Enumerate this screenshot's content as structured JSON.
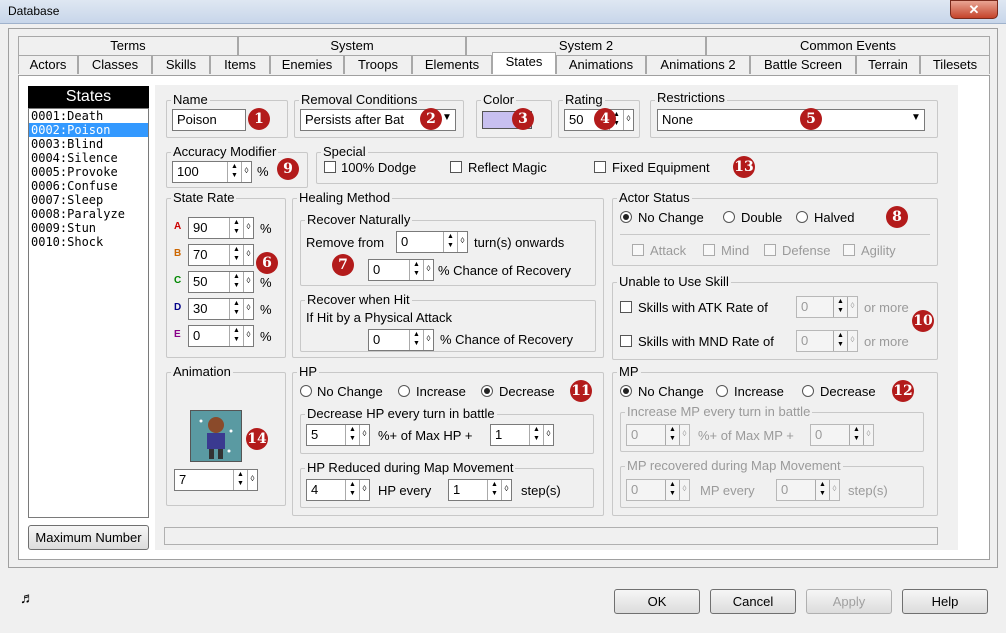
{
  "window": {
    "title": "Database",
    "close": "✕"
  },
  "tabs_row1": [
    "Terms",
    "System",
    "System 2",
    "Common Events"
  ],
  "tabs_row2": [
    "Actors",
    "Classes",
    "Skills",
    "Items",
    "Enemies",
    "Troops",
    "Elements",
    "States",
    "Animations",
    "Animations 2",
    "Battle Screen",
    "Terrain",
    "Tilesets"
  ],
  "selected_tab": "States",
  "states_list": {
    "header": "States",
    "items": [
      "0001:Death",
      "0002:Poison",
      "0003:Blind",
      "0004:Silence",
      "0005:Provoke",
      "0006:Confuse",
      "0007:Sleep",
      "0008:Paralyze",
      "0009:Stun",
      "0010:Shock"
    ],
    "selected_index": 1,
    "max_button": "Maximum Number"
  },
  "name": {
    "label": "Name",
    "value": "Poison"
  },
  "removal": {
    "label": "Removal Conditions",
    "value": "Persists after Bat"
  },
  "color": {
    "label": "Color",
    "swatch": "#c8c0f0"
  },
  "rating": {
    "label": "Rating",
    "value": "50"
  },
  "restrictions": {
    "label": "Restrictions",
    "value": "None"
  },
  "accuracy": {
    "label": "Accuracy Modifier",
    "value": "100",
    "unit": "%"
  },
  "special": {
    "label": "Special",
    "dodge": "100% Dodge",
    "reflect": "Reflect Magic",
    "fixed": "Fixed Equipment"
  },
  "state_rate": {
    "label": "State Rate",
    "rows": [
      {
        "letter": "A",
        "value": "90",
        "color": "#cc0000"
      },
      {
        "letter": "B",
        "value": "70",
        "color": "#cc6600"
      },
      {
        "letter": "C",
        "value": "50",
        "color": "#008800"
      },
      {
        "letter": "D",
        "value": "30",
        "color": "#000088"
      },
      {
        "letter": "E",
        "value": "0",
        "color": "#880088"
      }
    ],
    "unit": "%"
  },
  "healing": {
    "label": "Healing Method",
    "natural_label": "Recover Naturally",
    "remove_from": "Remove from",
    "remove_value": "0",
    "turns_onwards": "turn(s) onwards",
    "natural_chance": "0",
    "chance_text": "% Chance of Recovery",
    "hit_label": "Recover when Hit",
    "hit_desc": "If Hit by a Physical Attack",
    "hit_chance": "0"
  },
  "actor_status": {
    "label": "Actor Status",
    "options": [
      "No Change",
      "Double",
      "Halved"
    ],
    "checks": [
      "Attack",
      "Mind",
      "Defense",
      "Agility"
    ]
  },
  "unable_skill": {
    "label": "Unable to Use Skill",
    "atk": "Skills with ATK Rate of",
    "mnd": "Skills with MND Rate of",
    "atk_value": "0",
    "mnd_value": "0",
    "or_more": "or more"
  },
  "animation": {
    "label": "Animation",
    "value": "7"
  },
  "hp": {
    "label": "HP",
    "options": [
      "No Change",
      "Increase",
      "Decrease"
    ],
    "battle_label": "Decrease HP every turn in battle",
    "battle_pct": "5",
    "battle_mid": "%+ of Max HP +",
    "battle_flat": "1",
    "map_label": "HP Reduced during Map Movement",
    "map_value": "4",
    "map_every": "HP every",
    "map_steps": "1",
    "steps_text": "step(s)"
  },
  "mp": {
    "label": "MP",
    "options": [
      "No Change",
      "Increase",
      "Decrease"
    ],
    "battle_label": "Increase MP every turn in battle",
    "battle_pct": "0",
    "battle_mid": "%+ of Max MP +",
    "battle_flat": "0",
    "map_label": "MP recovered during Map Movement",
    "map_value": "0",
    "map_every": "MP every",
    "map_steps": "0",
    "steps_text": "step(s)"
  },
  "badges": [
    "1",
    "2",
    "3",
    "4",
    "5",
    "6",
    "7",
    "8",
    "9",
    "10",
    "11",
    "12",
    "13",
    "14"
  ],
  "buttons": {
    "ok": "OK",
    "cancel": "Cancel",
    "apply": "Apply",
    "help": "Help"
  }
}
